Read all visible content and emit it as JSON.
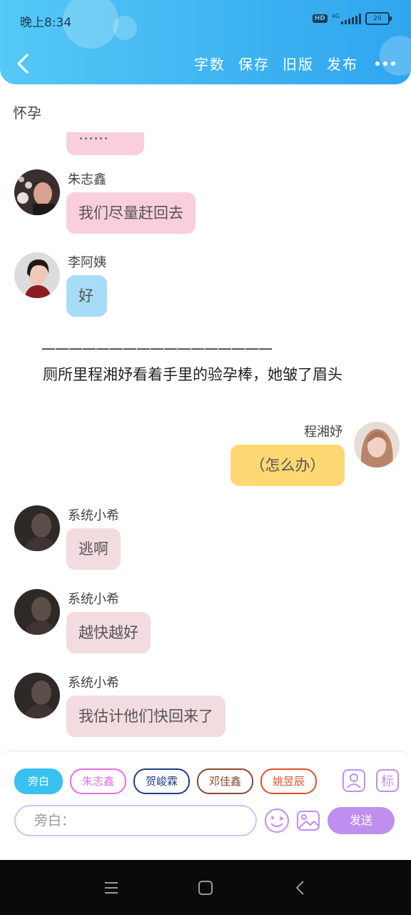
{
  "status_bar": {
    "time": "晚上8:34",
    "hd": "HD",
    "network": "4G",
    "battery": "26"
  },
  "header": {
    "actions": [
      "字数",
      "保存",
      "旧版",
      "发布"
    ],
    "back_icon": "back-arrow-icon",
    "more_icon": "more-dots-icon"
  },
  "chat": {
    "subtitle": "怀孕",
    "messages": [
      {
        "name": "",
        "text": "……",
        "style": "pink"
      },
      {
        "name": "朱志鑫",
        "text": "我们尽量赶回去",
        "style": "pink"
      },
      {
        "name": "李阿姨",
        "text": "好",
        "style": "blue"
      },
      {
        "name": "程湘妤",
        "text": "（怎么办）",
        "style": "yellow",
        "side": "right"
      },
      {
        "name": "系统小希",
        "text": "逃啊",
        "style": "grey"
      },
      {
        "name": "系统小希",
        "text": "越快越好",
        "style": "grey"
      },
      {
        "name": "系统小希",
        "text": "我估计他们快回来了",
        "style": "grey"
      }
    ],
    "divider": "—————————————————",
    "narration": "厕所里程湘妤看着手里的验孕棒，她皱了眉头"
  },
  "composer": {
    "characters": [
      {
        "label": "旁白",
        "color": "#39c0f0"
      },
      {
        "label": "朱志鑫",
        "color": "#e46fe0"
      },
      {
        "label": "贺峻霖",
        "color": "#1f3f87"
      },
      {
        "label": "邓佳鑫",
        "color": "#8a4a2d"
      },
      {
        "label": "姚昱辰",
        "color": "#e0502a"
      }
    ],
    "tag_label": "标",
    "placeholder": "旁白：",
    "send_label": "发送"
  },
  "colors": {
    "header": "#3fb4f2",
    "accent": "#bf8ff0",
    "pink_bubble": "#f9cfdc",
    "blue_bubble": "#a7dcf7",
    "yellow_bubble": "#fdd873",
    "grey_bubble": "#f2dcdf"
  }
}
